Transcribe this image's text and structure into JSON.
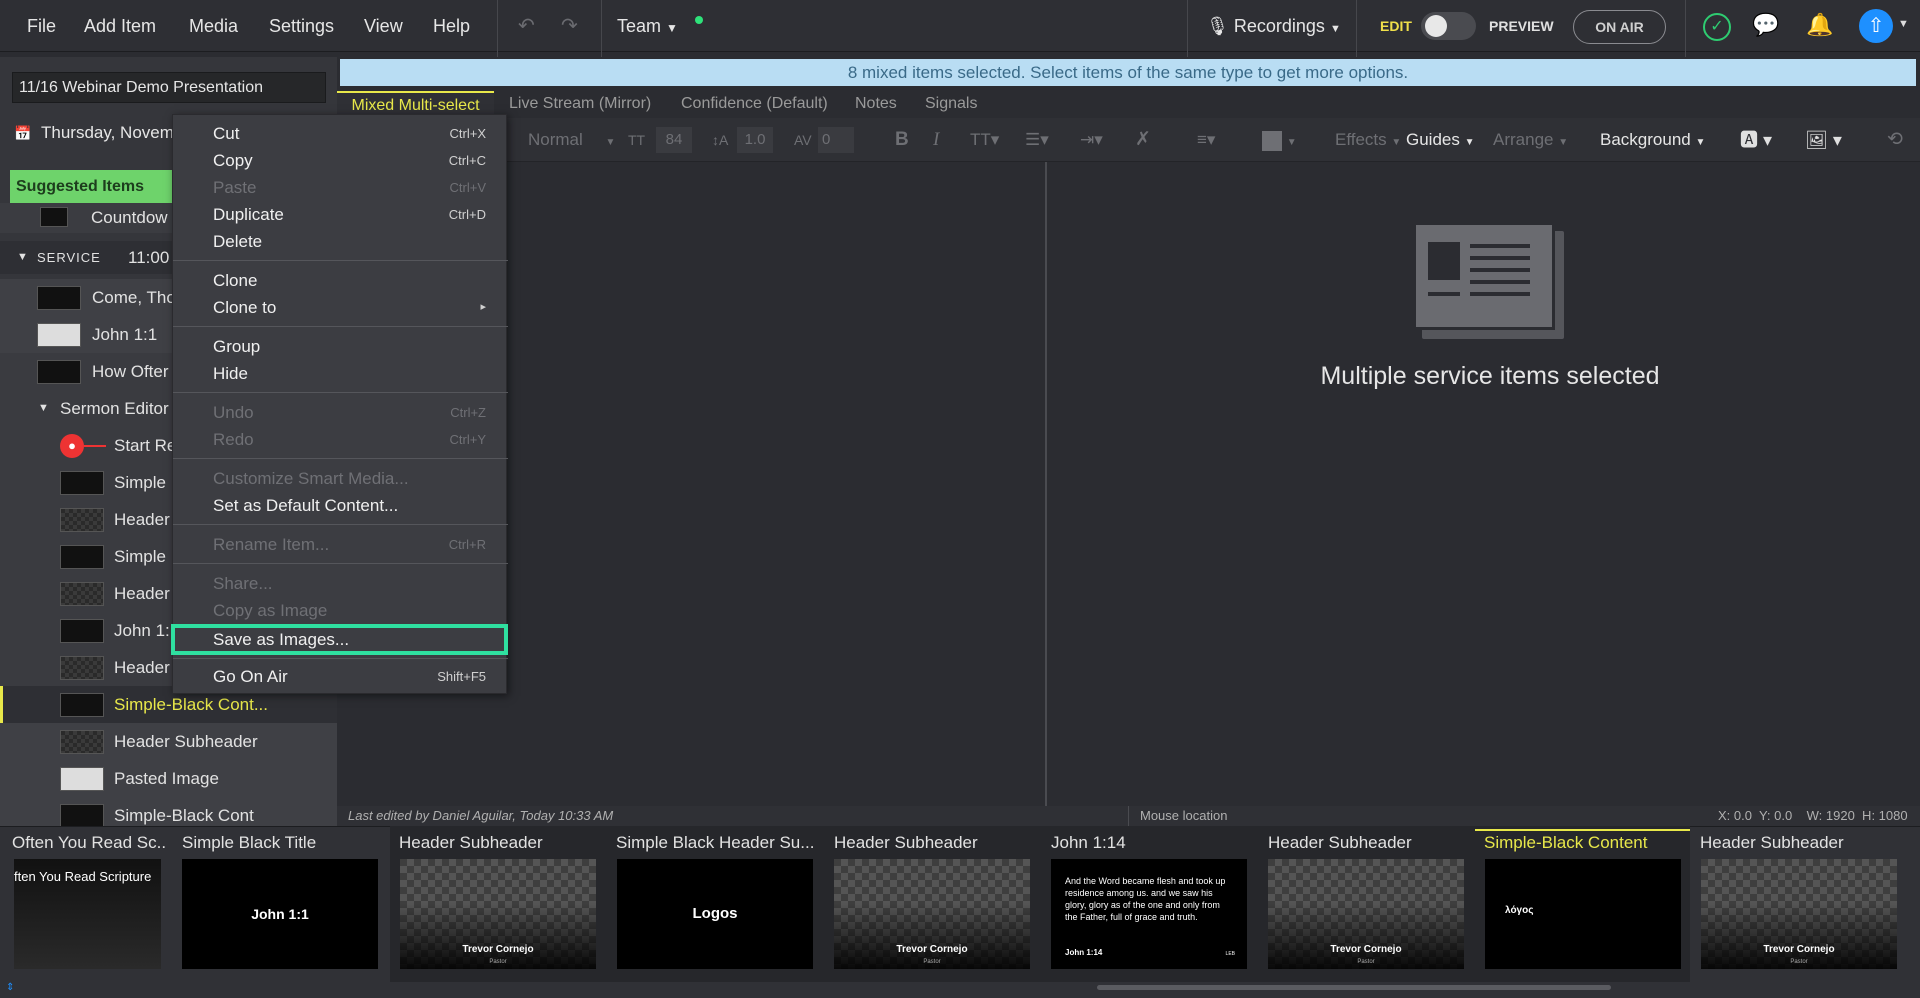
{
  "menubar": {
    "items": [
      "File",
      "Add Item",
      "Media",
      "Settings",
      "View",
      "Help"
    ],
    "team_label": "Team",
    "recordings_label": "Recordings",
    "edit_label": "EDIT",
    "preview_label": "PREVIEW",
    "on_air_label": "ON AIR"
  },
  "sidebar": {
    "presentation_name": "11/16 Webinar Demo Presentation",
    "date": "Thursday, Novem",
    "suggested_label": "Suggested Items",
    "rows": {
      "countdown": "Countdow",
      "service": "SERVICE",
      "service_time": "11:00",
      "come": "Come, Tho",
      "john11": "John 1:1",
      "how_often": "How Ofter",
      "sermon_editor": "Sermon Editor",
      "start_rec": "Start Re",
      "simple1": "Simple",
      "header1": "Header",
      "simple2": "Simple",
      "header2": "Header",
      "john1": "John 1:",
      "header3": "Header",
      "simple_black": "Simple-Black Cont...",
      "header_sub": "Header Subheader",
      "pasted_image": "Pasted Image",
      "simple_black2": "Simple-Black Cont"
    }
  },
  "banner": "8 mixed items selected. Select items of the same type to get more options.",
  "tabs": [
    "Mixed Multi-select",
    "Live Stream (Mirror)",
    "Confidence (Default)",
    "Notes",
    "Signals"
  ],
  "toolbar": {
    "style": "Normal",
    "font_size": "84",
    "line_height": "1.0",
    "spacing": "0",
    "effects": "Effects",
    "guides": "Guides",
    "arrange": "Arrange",
    "background": "Background"
  },
  "main": {
    "message": "Multiple service items selected"
  },
  "status": {
    "last_edited": "Last edited by Daniel Aguilar, Today 10:33 AM",
    "mouse_location": "Mouse location",
    "coords": "X: 0.0  Y: 0.0    W: 1920  H: 1080"
  },
  "context_menu": {
    "cut": "Cut",
    "cut_sc": "Ctrl+X",
    "copy": "Copy",
    "copy_sc": "Ctrl+C",
    "paste": "Paste",
    "paste_sc": "Ctrl+V",
    "duplicate": "Duplicate",
    "duplicate_sc": "Ctrl+D",
    "delete": "Delete",
    "clone": "Clone",
    "clone_to": "Clone to",
    "group": "Group",
    "hide": "Hide",
    "undo": "Undo",
    "undo_sc": "Ctrl+Z",
    "redo": "Redo",
    "redo_sc": "Ctrl+Y",
    "customize": "Customize Smart Media...",
    "set_default": "Set as Default Content...",
    "rename": "Rename Item...",
    "rename_sc": "Ctrl+R",
    "share": "Share...",
    "copy_image": "Copy as Image",
    "save_images": "Save as Images...",
    "go_on_air": "Go On Air",
    "go_on_air_sc": "Shift+F5"
  },
  "filmstrip": [
    {
      "title": "Often You Read Sc...",
      "content": "ften You Read Scripture"
    },
    {
      "title": "Simple Black Title",
      "content": "John 1:1"
    },
    {
      "title": "Header Subheader",
      "content": "Trevor Cornejo",
      "sub": "Pastor"
    },
    {
      "title": "Simple Black Header Su...",
      "content": "Logos"
    },
    {
      "title": "Header Subheader",
      "content": "Trevor Cornejo",
      "sub": "Pastor"
    },
    {
      "title": "John 1:14",
      "content": "And the Word became flesh and took up residence among us. and we saw his glory, glory as of the one and only from the Father, full of grace and truth.",
      "ref": "John 1:14",
      "version": "LEB"
    },
    {
      "title": "Header Subheader",
      "content": "Trevor Cornejo",
      "sub": "Pastor"
    },
    {
      "title": "Simple-Black Content",
      "content": "λόγος"
    },
    {
      "title": "Header Subheader",
      "content": "Trevor Cornejo",
      "sub": "Pastor"
    }
  ],
  "colors": {
    "accent_yellow": "#e8e84a",
    "banner_bg": "#b9ddf3",
    "suggested_bg": "#6ed36b",
    "highlight_border": "#2fe0a0",
    "profile_blue": "#1e90ff"
  }
}
